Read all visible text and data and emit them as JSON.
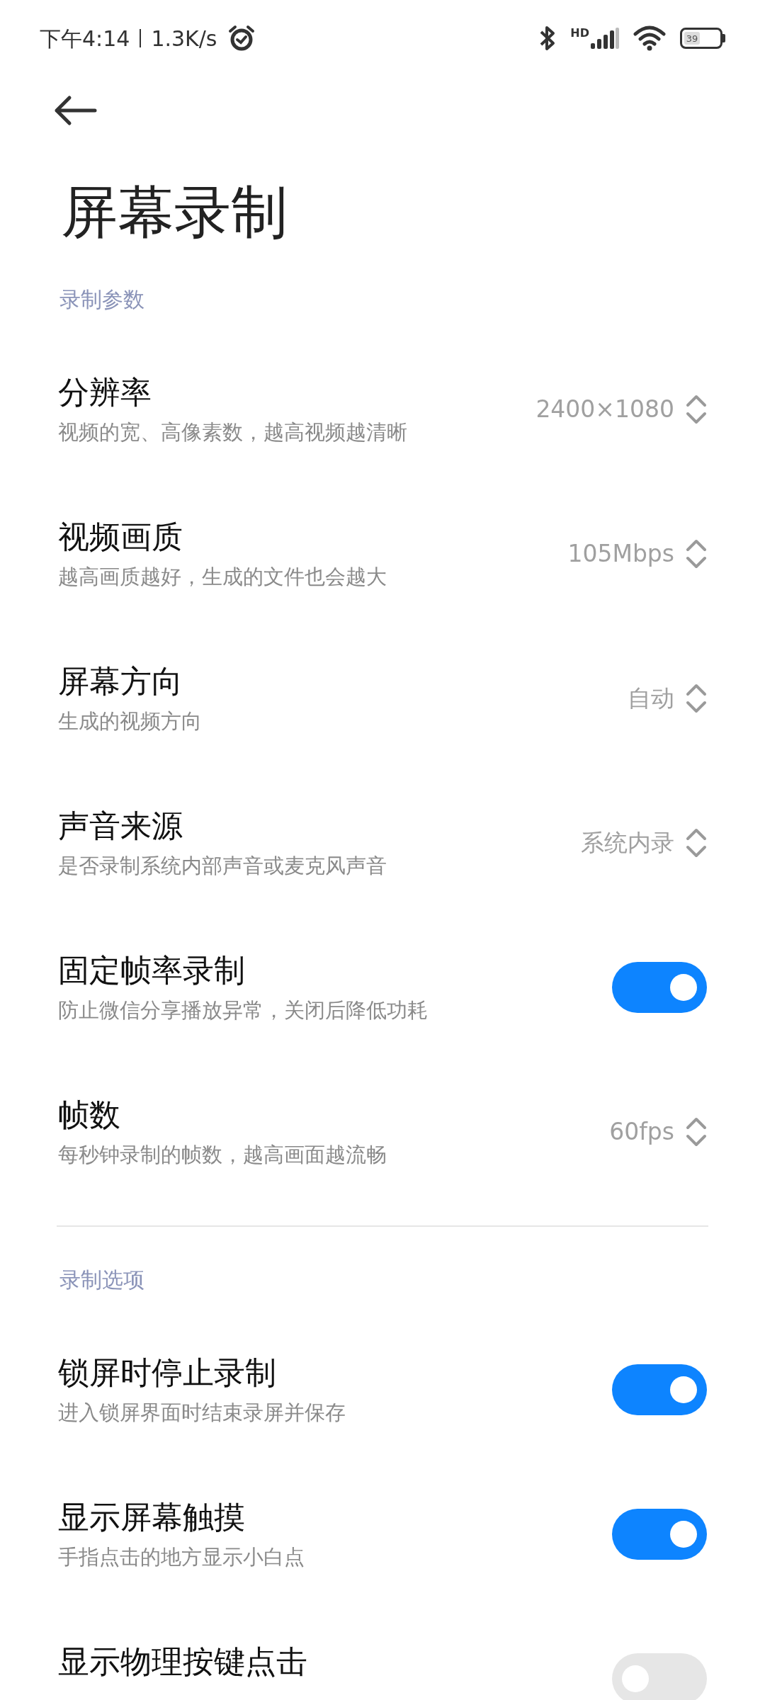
{
  "status_bar": {
    "time": "下午4:14",
    "speed": "1.3K/s",
    "network": "HD",
    "battery": "39"
  },
  "title": "屏幕录制",
  "sections": [
    {
      "header": "录制参数",
      "items": [
        {
          "kind": "select",
          "title": "分辨率",
          "subtitle": "视频的宽、高像素数，越高视频越清晰",
          "value": "2400×1080"
        },
        {
          "kind": "select",
          "title": "视频画质",
          "subtitle": "越高画质越好，生成的文件也会越大",
          "value": "105Mbps"
        },
        {
          "kind": "select",
          "title": "屏幕方向",
          "subtitle": "生成的视频方向",
          "value": "自动"
        },
        {
          "kind": "select",
          "title": "声音来源",
          "subtitle": "是否录制系统内部声音或麦克风声音",
          "value": "系统内录"
        },
        {
          "kind": "switch",
          "title": "固定帧率录制",
          "subtitle": "防止微信分享播放异常，关闭后降低功耗",
          "on": true
        },
        {
          "kind": "select",
          "title": "帧数",
          "subtitle": "每秒钟录制的帧数，越高画面越流畅",
          "value": "60fps"
        }
      ]
    },
    {
      "header": "录制选项",
      "items": [
        {
          "kind": "switch",
          "title": "锁屏时停止录制",
          "subtitle": "进入锁屏界面时结束录屏并保存",
          "on": true
        },
        {
          "kind": "switch",
          "title": "显示屏幕触摸",
          "subtitle": "手指点击的地方显示小白点",
          "on": true
        },
        {
          "kind": "switch",
          "title": "显示物理按键点击",
          "on": false
        }
      ]
    }
  ]
}
